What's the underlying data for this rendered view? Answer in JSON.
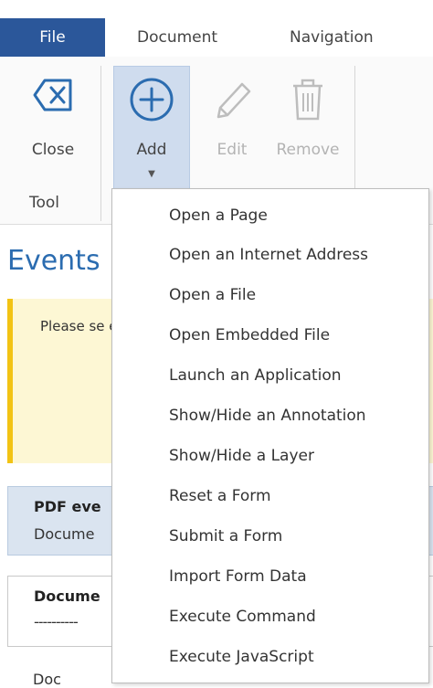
{
  "tabs": {
    "file": "File",
    "document": "Document",
    "navigation": "Navigation"
  },
  "ribbon": {
    "close": "Close",
    "add": "Add",
    "edit": "Edit",
    "remove": "Remove",
    "group": "Tool"
  },
  "panel": {
    "title": "Events",
    "note": "Please se event, wl you can c",
    "event_title": "PDF eve",
    "event_sub": "Docume",
    "doc_title": "Docume",
    "doc_dash": "----------",
    "bottom": "Doc"
  },
  "menu": {
    "items": [
      "Open a Page",
      "Open an Internet Address",
      "Open a File",
      "Open Embedded File",
      "Launch an Application",
      "Show/Hide an Annotation",
      "Show/Hide a Layer",
      "Reset a Form",
      "Submit a Form",
      "Import Form Data",
      "Execute Command",
      "Execute JavaScript"
    ]
  },
  "colors": {
    "file_tab": "#2b579a",
    "accent": "#2b6cb0",
    "add_pressed": "#cfdcee",
    "note_bg": "#fdf7d4",
    "note_bar": "#f2c314"
  }
}
